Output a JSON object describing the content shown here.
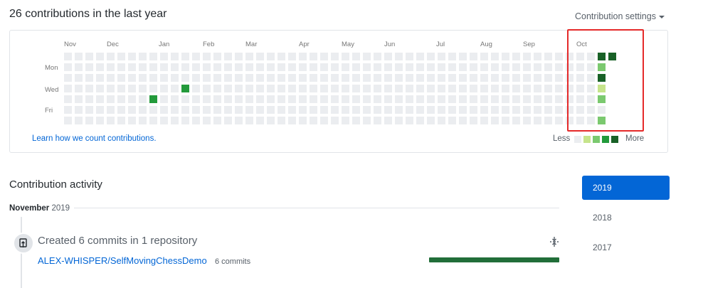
{
  "header": {
    "title": "26 contributions in the last year",
    "settings_label": "Contribution settings"
  },
  "calendar": {
    "months": [
      "Nov",
      "Dec",
      "Jan",
      "Feb",
      "Mar",
      "Apr",
      "May",
      "Jun",
      "Jul",
      "Aug",
      "Sep",
      "Oct"
    ],
    "weekdays": [
      "Mon",
      "Wed",
      "Fri"
    ],
    "learn_link": "Learn how we count contributions.",
    "legend_less": "Less",
    "legend_more": "More",
    "colors": [
      "#ebedf0",
      "#c6e48b",
      "#7bc96f",
      "#239a3b",
      "#196127"
    ],
    "active_cells": [
      {
        "week": 8,
        "day": 4,
        "level": 3
      },
      {
        "week": 11,
        "day": 3,
        "level": 3
      },
      {
        "week": 50,
        "day": 0,
        "level": 4
      },
      {
        "week": 51,
        "day": 0,
        "level": 4
      },
      {
        "week": 50,
        "day": 1,
        "level": 2
      },
      {
        "week": 50,
        "day": 2,
        "level": 4
      },
      {
        "week": 50,
        "day": 3,
        "level": 1
      },
      {
        "week": 50,
        "day": 4,
        "level": 2
      },
      {
        "week": 50,
        "day": 6,
        "level": 2
      }
    ]
  },
  "activity": {
    "title": "Contribution activity",
    "month": "November",
    "year": "2019",
    "summary": "Created 6 commits in 1 repository",
    "repo": "ALEX-WHISPER/SelfMovingChessDemo",
    "repo_commits": "6 commits",
    "bar_fraction": 1.0
  },
  "years": [
    "2019",
    "2018",
    "2017"
  ],
  "selected_year": "2019"
}
